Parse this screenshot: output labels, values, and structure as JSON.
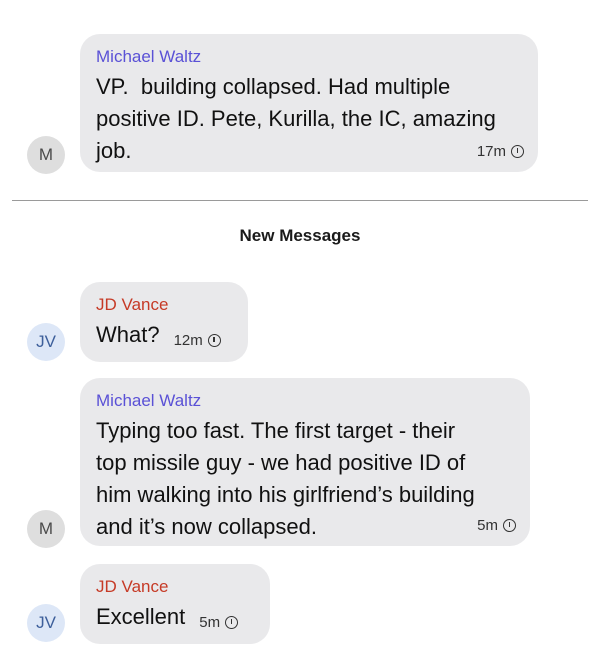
{
  "divider_label": "New Messages",
  "messages": [
    {
      "avatar": "M",
      "sender": "Michael Waltz",
      "text": "VP.  building collapsed. Had multiple\npositive ID. Pete, Kurilla, the IC, amazing\njob.",
      "time": "17m"
    },
    {
      "avatar": "JV",
      "sender": "JD Vance",
      "text": "What?",
      "time": "12m"
    },
    {
      "avatar": "M",
      "sender": "Michael Waltz",
      "text": "Typing too fast. The first target - their\ntop missile guy - we had positive ID of\nhim walking into his girlfriend’s building\nand it’s now collapsed.",
      "time": "5m"
    },
    {
      "avatar": "JV",
      "sender": "JD Vance",
      "text": "Excellent",
      "time": "5m"
    }
  ],
  "colors": {
    "bubble": "#e9e9eb",
    "waltz_name": "#5a51d6",
    "vance_name": "#c63a26"
  },
  "icons": {
    "timestamp": "clock-icon"
  }
}
